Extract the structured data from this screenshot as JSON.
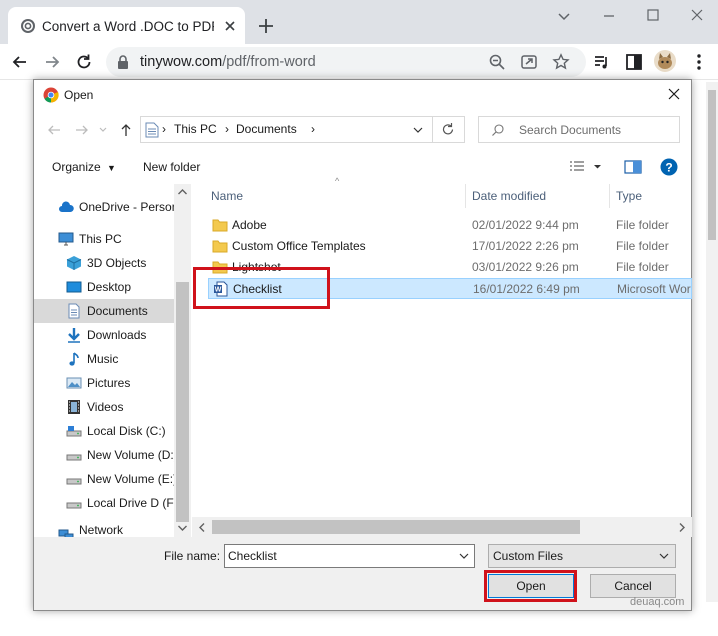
{
  "browser": {
    "tab_title": "Convert a Word .DOC to PDF Onl",
    "url_host": "tinywow.com",
    "url_path": "/pdf/from-word"
  },
  "dialog": {
    "title": "Open",
    "breadcrumb": [
      "This PC",
      "Documents"
    ],
    "search_placeholder": "Search Documents",
    "organize_label": "Organize",
    "new_folder_label": "New folder",
    "nav_items": [
      {
        "label": "OneDrive - Person",
        "icon": "cloud-icon"
      },
      {
        "label": "This PC",
        "icon": "computer-icon"
      },
      {
        "label": "3D Objects",
        "icon": "cube-icon"
      },
      {
        "label": "Desktop",
        "icon": "desktop-icon"
      },
      {
        "label": "Documents",
        "icon": "document-icon",
        "selected": true
      },
      {
        "label": "Downloads",
        "icon": "download-icon"
      },
      {
        "label": "Music",
        "icon": "music-icon"
      },
      {
        "label": "Pictures",
        "icon": "pictures-icon"
      },
      {
        "label": "Videos",
        "icon": "videos-icon"
      },
      {
        "label": "Local Disk (C:)",
        "icon": "drive-icon"
      },
      {
        "label": "New Volume (D:)",
        "icon": "drive-icon"
      },
      {
        "label": "New Volume (E:)",
        "icon": "drive-icon"
      },
      {
        "label": "Local Drive D (F:)",
        "icon": "drive-icon"
      },
      {
        "label": "Network",
        "icon": "network-icon"
      }
    ],
    "columns": {
      "name": "Name",
      "date": "Date modified",
      "type": "Type"
    },
    "files": [
      {
        "name": "Adobe",
        "date": "02/01/2022 9:44 pm",
        "type": "File folder",
        "icon": "folder-icon"
      },
      {
        "name": "Custom Office Templates",
        "date": "17/01/2022 2:26 pm",
        "type": "File folder",
        "icon": "folder-icon"
      },
      {
        "name": "Lightshot",
        "date": "03/01/2022 9:26 pm",
        "type": "File folder",
        "icon": "folder-icon"
      },
      {
        "name": "Checklist",
        "date": "16/01/2022 6:49 pm",
        "type": "Microsoft Wor",
        "icon": "word-doc-icon",
        "selected": true
      }
    ],
    "file_name_label": "File name:",
    "file_name_value": "Checklist",
    "file_type_value": "Custom Files",
    "open_label": "Open",
    "cancel_label": "Cancel"
  },
  "watermark": "deuaq.com",
  "colors": {
    "highlight": "#d0121b",
    "selection": "#cce8ff",
    "accent": "#0078d7"
  }
}
